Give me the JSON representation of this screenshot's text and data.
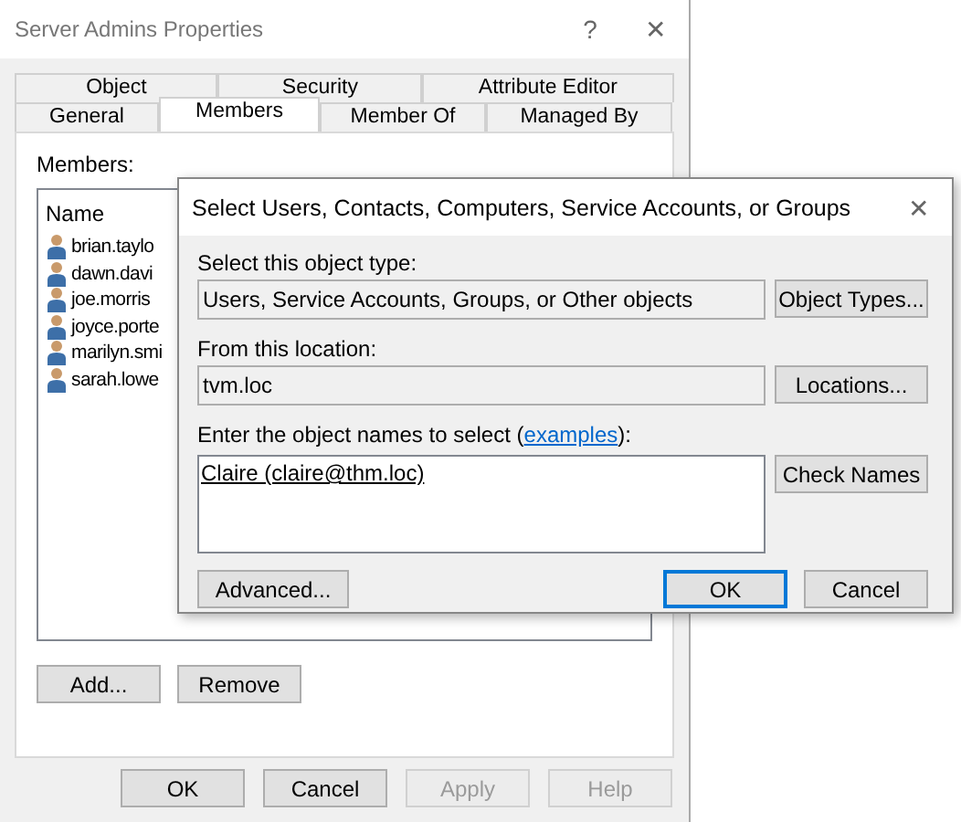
{
  "window": {
    "title": "Server Admins Properties",
    "help": "?",
    "close": "✕"
  },
  "tab_rows": [
    [
      {
        "label": "Object",
        "selected": false
      },
      {
        "label": "Security",
        "selected": false
      },
      {
        "label": "Attribute Editor",
        "selected": false
      }
    ],
    [
      {
        "label": "General",
        "selected": false
      },
      {
        "label": "Members",
        "selected": true
      },
      {
        "label": "Member Of",
        "selected": false
      },
      {
        "label": "Managed By",
        "selected": false
      }
    ]
  ],
  "members": {
    "label": "Members:",
    "column": "Name",
    "rows": [
      "brian.taylo",
      "dawn.davi",
      "joe.morris",
      "joyce.porte",
      "marilyn.smi",
      "sarah.lowe"
    ],
    "buttons": [
      {
        "label": "Add...",
        "disabled": false
      },
      {
        "label": "Remove",
        "disabled": false
      }
    ]
  },
  "footer_buttons": [
    {
      "label": "OK",
      "disabled": false
    },
    {
      "label": "Cancel",
      "disabled": false
    },
    {
      "label": "Apply",
      "disabled": true
    },
    {
      "label": "Help",
      "disabled": true
    }
  ],
  "dialog": {
    "title": "Select Users, Contacts, Computers, Service Accounts, or Groups",
    "close": "✕",
    "object_type": {
      "label": "Select this object type:",
      "value": "Users, Service Accounts, Groups, or Other objects",
      "button": "Object Types..."
    },
    "location": {
      "label": "From this location:",
      "value": "tvm.loc",
      "button": "Locations..."
    },
    "names": {
      "label_before": "Enter the object names to select (",
      "link": "examples",
      "label_after": "):",
      "value": "Claire (claire@thm.loc)",
      "button": "Check Names"
    },
    "advanced": "Advanced...",
    "ok": "OK",
    "cancel": "Cancel"
  }
}
